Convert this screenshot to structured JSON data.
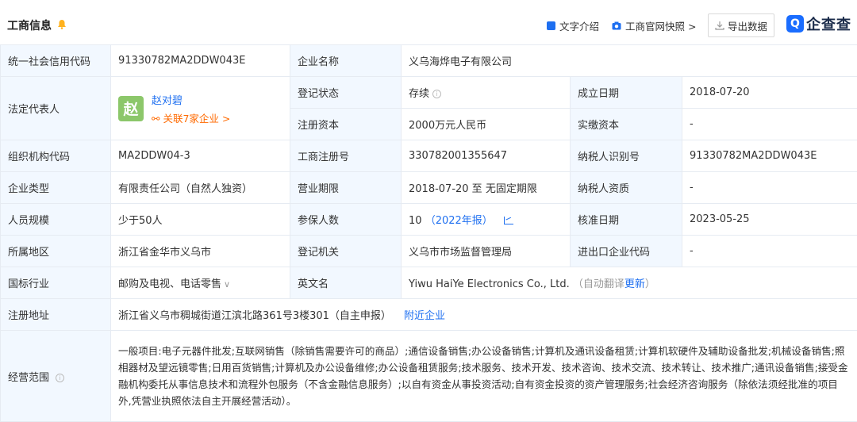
{
  "header": {
    "title": "工商信息",
    "text_intro": "文字介绍",
    "official_snapshot": "工商官网快照 >",
    "export": "导出数据",
    "logo_mark": "Q",
    "logo_text": "企查查"
  },
  "colors": {
    "accent": "#1e6ff0",
    "label_bg": "#f2f8ff",
    "orange": "#ff6a00",
    "avatar_bg": "#8cc76a"
  },
  "rows": {
    "credit_code_label": "统一社会信用代码",
    "credit_code": "91330782MA2DDW043E",
    "company_name_label": "企业名称",
    "company_name": "义乌海烨电子有限公司",
    "legal_rep_label": "法定代表人",
    "avatar_char": "赵",
    "rep_name": "赵对碧",
    "rep_related": "关联7家企业 >",
    "reg_status_label": "登记状态",
    "reg_status": "存续",
    "found_date_label": "成立日期",
    "found_date": "2018-07-20",
    "reg_capital_label": "注册资本",
    "reg_capital": "2000万元人民币",
    "paid_capital_label": "实缴资本",
    "paid_capital": "-",
    "org_code_label": "组织机构代码",
    "org_code": "MA2DDW04-3",
    "biz_reg_no_label": "工商注册号",
    "biz_reg_no": "330782001355647",
    "taxpayer_id_label": "纳税人识别号",
    "taxpayer_id": "91330782MA2DDW043E",
    "company_type_label": "企业类型",
    "company_type": "有限责任公司（自然人独资）",
    "biz_term_label": "营业期限",
    "biz_term": "2018-07-20 至 无固定期限",
    "taxpayer_qual_label": "纳税人资质",
    "taxpayer_qual": "-",
    "staff_label": "人员规模",
    "staff": "少于50人",
    "insured_label": "参保人数",
    "insured": "10",
    "insured_year": "（2022年报）",
    "approve_date_label": "核准日期",
    "approve_date": "2023-05-25",
    "region_label": "所属地区",
    "region": "浙江省金华市义乌市",
    "reg_authority_label": "登记机关",
    "reg_authority": "义乌市市场监督管理局",
    "import_export_label": "进出口企业代码",
    "import_export": "-",
    "industry_label": "国标行业",
    "industry": "邮购及电视、电话零售",
    "english_name_label": "英文名",
    "english_name": "Yiwu HaiYe Electronics Co., Ltd.",
    "auto_translate": "（自动翻译",
    "update": "更新",
    "auto_translate_end": "）",
    "address_label": "注册地址",
    "address": "浙江省义乌市稠城街道江滨北路361号3楼301（自主申报）",
    "nearby": "附近企业",
    "scope_label": "经营范围",
    "scope": "一般项目:电子元器件批发;互联网销售（除销售需要许可的商品）;通信设备销售;办公设备销售;计算机及通讯设备租赁;计算机软硬件及辅助设备批发;机械设备销售;照相器材及望远镜零售;日用百货销售;计算机及办公设备维修;办公设备租赁服务;技术服务、技术开发、技术咨询、技术交流、技术转让、技术推广;通讯设备销售;接受金融机构委托从事信息技术和流程外包服务（不含金融信息服务）;以自有资金从事投资活动;自有资金投资的资产管理服务;社会经济咨询服务（除依法须经批准的项目外,凭营业执照依法自主开展经营活动）。"
  }
}
